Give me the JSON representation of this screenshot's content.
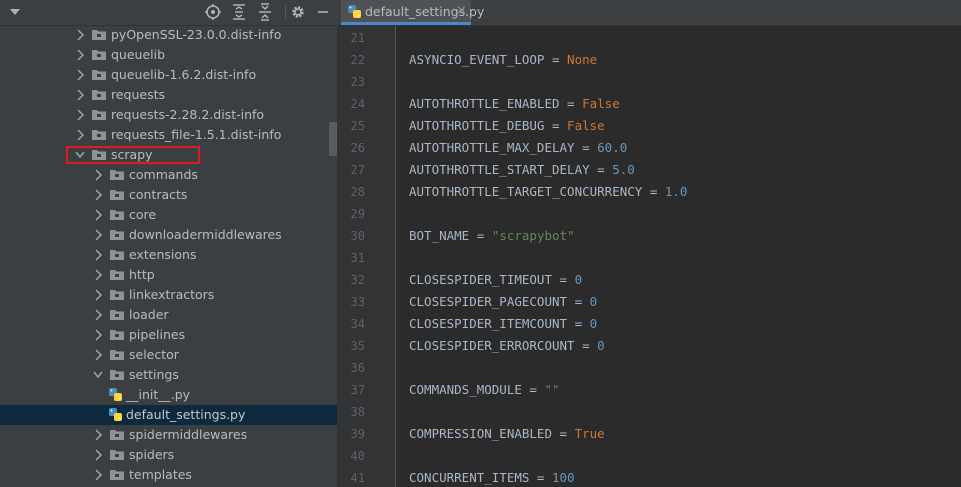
{
  "project": {
    "tree": [
      {
        "label": "pyOpenSSL-23.0.0.dist-info",
        "type": "folder",
        "level": 0,
        "expanded": false
      },
      {
        "label": "queuelib",
        "type": "folder",
        "level": 0,
        "expanded": false
      },
      {
        "label": "queuelib-1.6.2.dist-info",
        "type": "folder",
        "level": 0,
        "expanded": false
      },
      {
        "label": "requests",
        "type": "folder",
        "level": 0,
        "expanded": false
      },
      {
        "label": "requests-2.28.2.dist-info",
        "type": "folder",
        "level": 0,
        "expanded": false
      },
      {
        "label": "requests_file-1.5.1.dist-info",
        "type": "folder",
        "level": 0,
        "expanded": false
      },
      {
        "label": "scrapy",
        "type": "folder",
        "level": 0,
        "expanded": true,
        "highlighted": true
      },
      {
        "label": "commands",
        "type": "folder",
        "level": 1,
        "expanded": false
      },
      {
        "label": "contracts",
        "type": "folder",
        "level": 1,
        "expanded": false
      },
      {
        "label": "core",
        "type": "folder",
        "level": 1,
        "expanded": false
      },
      {
        "label": "downloadermiddlewares",
        "type": "folder",
        "level": 1,
        "expanded": false
      },
      {
        "label": "extensions",
        "type": "folder",
        "level": 1,
        "expanded": false
      },
      {
        "label": "http",
        "type": "folder",
        "level": 1,
        "expanded": false
      },
      {
        "label": "linkextractors",
        "type": "folder",
        "level": 1,
        "expanded": false
      },
      {
        "label": "loader",
        "type": "folder",
        "level": 1,
        "expanded": false
      },
      {
        "label": "pipelines",
        "type": "folder",
        "level": 1,
        "expanded": false
      },
      {
        "label": "selector",
        "type": "folder",
        "level": 1,
        "expanded": false
      },
      {
        "label": "settings",
        "type": "folder",
        "level": 1,
        "expanded": true
      },
      {
        "label": "__init__.py",
        "type": "pyfile",
        "level": 2
      },
      {
        "label": "default_settings.py",
        "type": "pyfile",
        "level": 2,
        "selected": true
      },
      {
        "label": "spidermiddlewares",
        "type": "folder",
        "level": 1,
        "expanded": false
      },
      {
        "label": "spiders",
        "type": "folder",
        "level": 1,
        "expanded": false
      },
      {
        "label": "templates",
        "type": "folder",
        "level": 1,
        "expanded": false
      }
    ],
    "toolbar_icons": [
      "locate-icon",
      "expand-all-icon",
      "collapse-all-icon",
      "gear-icon",
      "hide-icon"
    ]
  },
  "editor": {
    "tab": {
      "label": "default_settings.py",
      "close": "×"
    },
    "lines": [
      {
        "n": "21",
        "tokens": []
      },
      {
        "n": "22",
        "tokens": [
          {
            "t": "ASYNCIO_EVENT_LOOP = ",
            "c": ""
          },
          {
            "t": "None",
            "c": "kw"
          }
        ]
      },
      {
        "n": "23",
        "tokens": []
      },
      {
        "n": "24",
        "tokens": [
          {
            "t": "AUTOTHROTTLE_ENABLED = ",
            "c": ""
          },
          {
            "t": "False",
            "c": "kw"
          }
        ]
      },
      {
        "n": "25",
        "tokens": [
          {
            "t": "AUTOTHROTTLE_DEBUG = ",
            "c": ""
          },
          {
            "t": "False",
            "c": "kw"
          }
        ]
      },
      {
        "n": "26",
        "tokens": [
          {
            "t": "AUTOTHROTTLE_MAX_DELAY = ",
            "c": ""
          },
          {
            "t": "60.0",
            "c": "num"
          }
        ]
      },
      {
        "n": "27",
        "tokens": [
          {
            "t": "AUTOTHROTTLE_START_DELAY = ",
            "c": ""
          },
          {
            "t": "5.0",
            "c": "num"
          }
        ]
      },
      {
        "n": "28",
        "tokens": [
          {
            "t": "AUTOTHROTTLE_TARGET_CONCURRENCY = ",
            "c": ""
          },
          {
            "t": "1.0",
            "c": "num"
          }
        ]
      },
      {
        "n": "29",
        "tokens": []
      },
      {
        "n": "30",
        "tokens": [
          {
            "t": "BOT_NAME = ",
            "c": ""
          },
          {
            "t": "\"scrapybot\"",
            "c": "str"
          }
        ]
      },
      {
        "n": "31",
        "tokens": []
      },
      {
        "n": "32",
        "tokens": [
          {
            "t": "CLOSESPIDER_TIMEOUT = ",
            "c": ""
          },
          {
            "t": "0",
            "c": "num"
          }
        ]
      },
      {
        "n": "33",
        "tokens": [
          {
            "t": "CLOSESPIDER_PAGECOUNT = ",
            "c": ""
          },
          {
            "t": "0",
            "c": "num"
          }
        ]
      },
      {
        "n": "34",
        "tokens": [
          {
            "t": "CLOSESPIDER_ITEMCOUNT = ",
            "c": ""
          },
          {
            "t": "0",
            "c": "num"
          }
        ]
      },
      {
        "n": "35",
        "tokens": [
          {
            "t": "CLOSESPIDER_ERRORCOUNT = ",
            "c": ""
          },
          {
            "t": "0",
            "c": "num"
          }
        ]
      },
      {
        "n": "36",
        "tokens": []
      },
      {
        "n": "37",
        "tokens": [
          {
            "t": "COMMANDS_MODULE = ",
            "c": ""
          },
          {
            "t": "\"\"",
            "c": "str"
          }
        ]
      },
      {
        "n": "38",
        "tokens": []
      },
      {
        "n": "39",
        "tokens": [
          {
            "t": "COMPRESSION_ENABLED = ",
            "c": ""
          },
          {
            "t": "True",
            "c": "kw"
          }
        ]
      },
      {
        "n": "40",
        "tokens": []
      },
      {
        "n": "41",
        "tokens": [
          {
            "t": "CONCURRENT_ITEMS = ",
            "c": ""
          },
          {
            "t": "100",
            "c": "num"
          }
        ]
      }
    ]
  },
  "colors": {
    "panel_bg": "#3c3f41",
    "editor_bg": "#2b2b2b",
    "selection": "#0d293e",
    "highlight_box": "#e01b1b",
    "keyword": "#cc7832",
    "number": "#6897bb",
    "string": "#6a8759"
  }
}
